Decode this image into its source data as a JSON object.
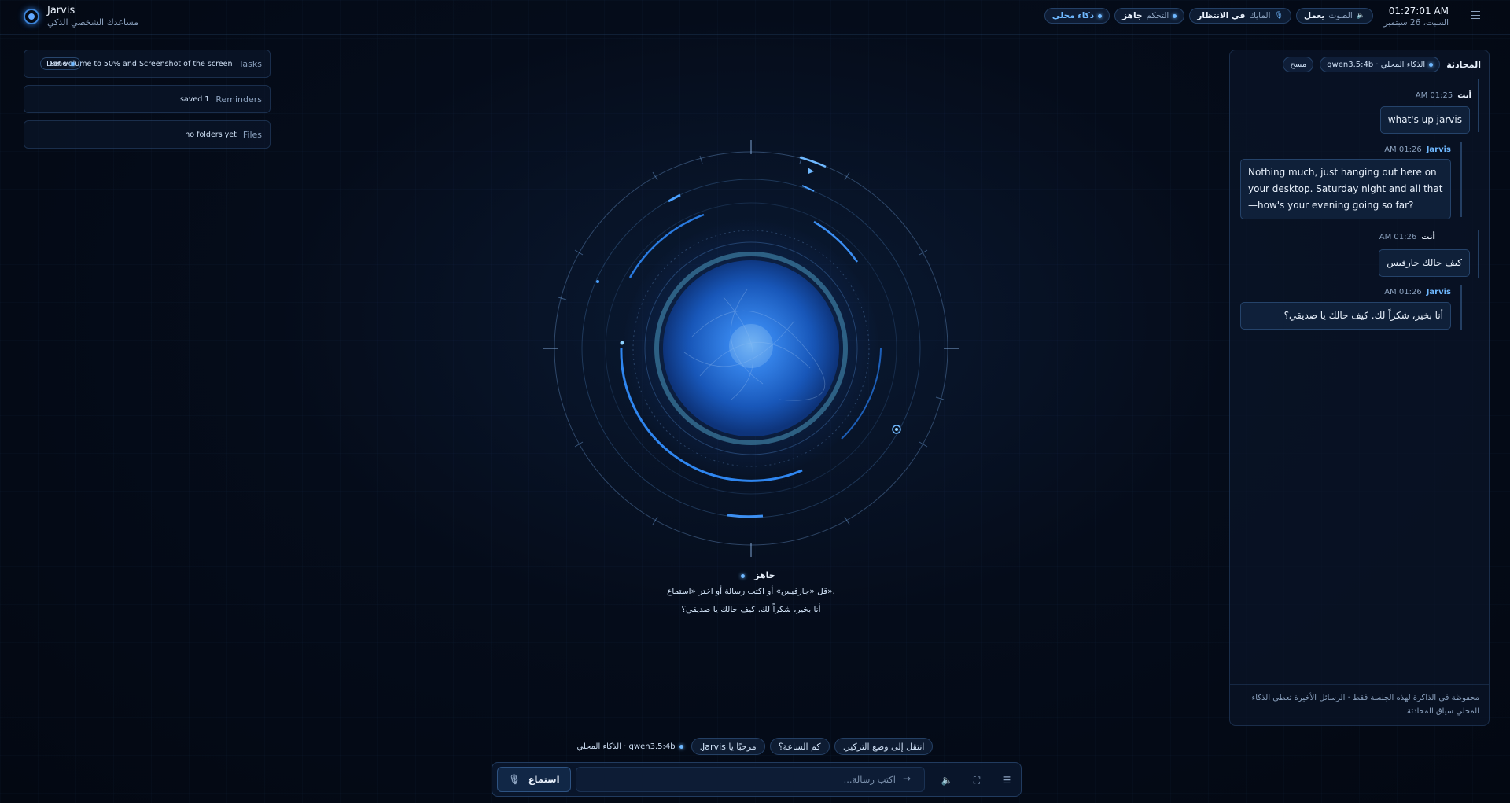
{
  "app": {
    "name": "Jarvis",
    "subtitle": "مساعدك الشخصي الذكي"
  },
  "header": {
    "time": "01:27:01 AM",
    "date": "السبت، 26 سبتمبر",
    "pills": [
      {
        "value": "يعمل",
        "label": "الصوت",
        "icon": "speaker-icon"
      },
      {
        "value": "في الانتظار",
        "label": "المايك",
        "icon": "mic-icon"
      },
      {
        "value": "جاهز",
        "label": "التحكم",
        "icon": "dot"
      },
      {
        "value": "ذكاء محلي",
        "label": "",
        "icon": "dot"
      }
    ]
  },
  "widgets": {
    "tasks": {
      "label": "Tasks",
      "value": "Set volume to 50% and Screenshot of the screen",
      "badge": "Done"
    },
    "reminders": {
      "label": "Reminders",
      "value": "saved 1"
    },
    "files": {
      "label": "Files",
      "value": "no folders yet"
    }
  },
  "orb": {
    "status": "جاهز",
    "hint": "قل «جارفيس» أو اكتب رسالة أو اختر «استماع».",
    "last_reply": "أنا بخير، شكراً لك. كيف حالك يا صديقي؟"
  },
  "chat": {
    "title": "المحادثة",
    "model": "qwen3.5:4b · الذكاء المحلي",
    "clear": "مسح",
    "messages": [
      {
        "who": "أنت",
        "time": "01:25 AM",
        "text": "what's up jarvis"
      },
      {
        "who": "Jarvis",
        "time": "01:26 AM",
        "text": "Nothing much, just hanging out here on your desktop. Saturday night and all that—how's your evening going so far?"
      },
      {
        "who": "أنت",
        "time": "01:26 AM",
        "text": "كيف حالك جارفيس"
      },
      {
        "who": "Jarvis",
        "time": "01:26 AM",
        "text": "أنا بخير، شكراً لك. كيف حالك يا صديقي؟"
      }
    ],
    "footer": "محفوظة في الذاكرة لهذه الجلسة فقط · الرسائل الأخيرة تعطي الذكاء المحلي سياق المحادثة"
  },
  "suggestions": {
    "chips": [
      "انتقل إلى وضع التركيز.",
      "كم الساعة؟",
      "مرحبًا يا Jarvis."
    ],
    "model": "qwen3.5:4b · الذكاء المحلي"
  },
  "input": {
    "listen_label": "استماع",
    "placeholder": "اكتب رسالة..."
  },
  "colors": {
    "accent": "#6fb8ff",
    "background": "#050c1a",
    "panel": "#0a162a"
  }
}
